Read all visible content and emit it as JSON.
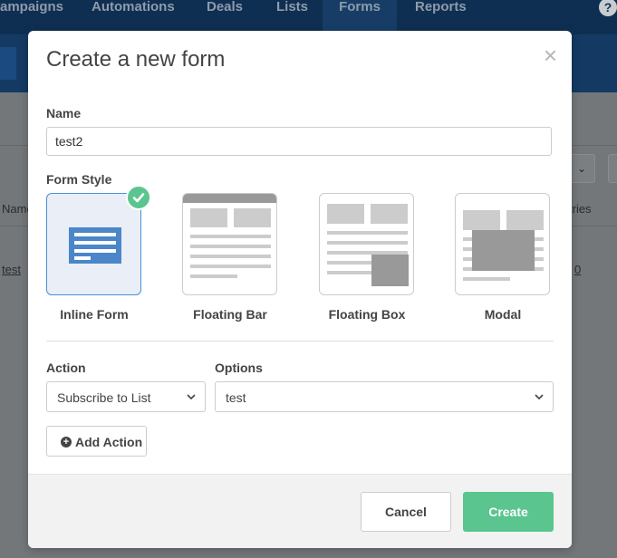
{
  "app_nav": {
    "items": [
      "ampaigns",
      "Automations",
      "Deals",
      "Lists",
      "Forms",
      "Reports"
    ],
    "active": "Forms",
    "help_label": "?"
  },
  "background_page": {
    "column_name_fragment": "Name",
    "column_entries_fragment": "tries",
    "row_name": "test",
    "row_entries": "0"
  },
  "modal": {
    "title": "Create a new form",
    "close_label": "×",
    "name_label": "Name",
    "name_value": "test2",
    "form_style_label": "Form Style",
    "styles": [
      {
        "label": "Inline Form",
        "selected": true
      },
      {
        "label": "Floating Bar",
        "selected": false
      },
      {
        "label": "Floating Box",
        "selected": false
      },
      {
        "label": "Modal",
        "selected": false
      }
    ],
    "action_label": "Action",
    "action_value": "Subscribe to List",
    "options_label": "Options",
    "options_value": "test",
    "add_action_label": "Add Action",
    "cancel_label": "Cancel",
    "create_label": "Create"
  },
  "colors": {
    "accent_green": "#5ac58f",
    "selected_blue": "#4a90d9",
    "nav_bg": "#0f2f52"
  }
}
